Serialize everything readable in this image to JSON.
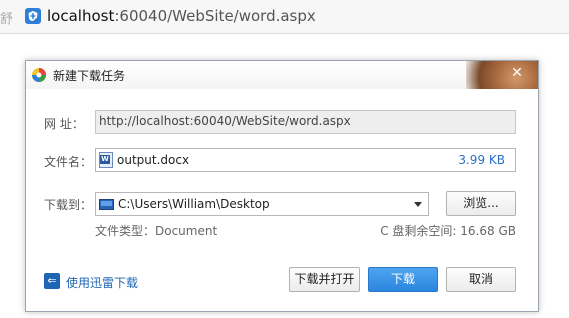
{
  "browser": {
    "address_host": "localhost",
    "address_rest": ":60040/WebSite/word.aspx",
    "left_fragment": "舒"
  },
  "dialog": {
    "title": "新建下载任务",
    "close_glyph": "✕",
    "url_label": "网  址：",
    "url_value": "http://localhost:60040/WebSite/word.aspx",
    "filename_label": "文件名：",
    "filename_value": "output.docx",
    "file_icon_letter": "W",
    "file_size": "3.99 KB",
    "downloadto_label": "下载到：",
    "path_value": "C:\\Users\\William\\Desktop",
    "browse_label": "浏览...",
    "file_type": "文件类型：Document",
    "free_space": "C 盘剩余空间: 16.68 GB",
    "xunlei_label": "使用迅雷下载",
    "xunlei_glyph": "⇐",
    "download_open_label": "下载并打开",
    "download_label": "下载",
    "cancel_label": "取消"
  },
  "colors": {
    "accent_blue": "#2a86de",
    "link_blue": "#1e66b3",
    "size_blue": "#2a6fc9"
  },
  "icons": {
    "address": "shield-icon",
    "title": "browser-logo-icon",
    "file": "word-document-icon",
    "folder": "desktop-folder-icon",
    "xunlei": "xunlei-icon",
    "dropdown": "chevron-down-icon"
  }
}
